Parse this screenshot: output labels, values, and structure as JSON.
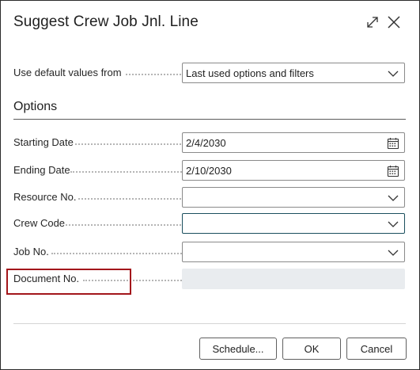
{
  "dialog": {
    "title": "Suggest Crew Job Jnl. Line",
    "expand_icon": "expand-icon",
    "close_icon": "close-icon"
  },
  "defaults": {
    "label": "Use default values from",
    "value": "Last used options and filters"
  },
  "options": {
    "heading": "Options",
    "starting_date": {
      "label": "Starting Date",
      "value": "2/4/2030"
    },
    "ending_date": {
      "label": "Ending Date",
      "value": "2/10/2030"
    },
    "resource_no": {
      "label": "Resource No.",
      "value": ""
    },
    "crew_code": {
      "label": "Crew Code",
      "value": ""
    },
    "job_no": {
      "label": "Job No.",
      "value": ""
    },
    "document_no": {
      "label": "Document No.",
      "value": ""
    }
  },
  "buttons": {
    "schedule": "Schedule...",
    "ok": "OK",
    "cancel": "Cancel"
  },
  "colors": {
    "highlight_border": "#a3161b",
    "focus_border": "#1b4f5e",
    "disabled_fill": "#e9ecef"
  }
}
